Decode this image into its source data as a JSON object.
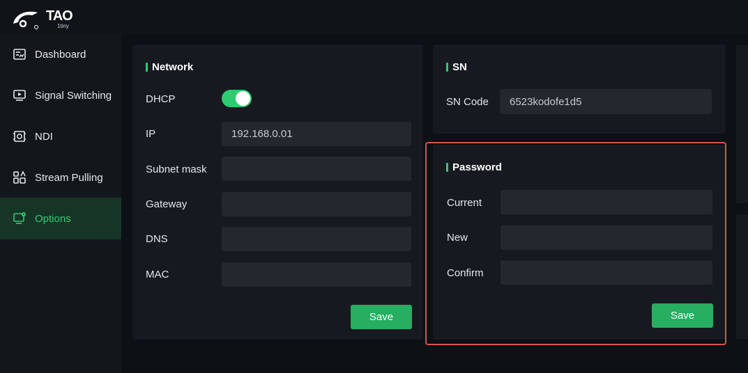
{
  "logo": {
    "name": "TAO",
    "sub": "1tiny"
  },
  "sidebar": {
    "items": [
      {
        "label": "Dashboard",
        "icon": "dashboard-icon",
        "active": false
      },
      {
        "label": "Signal Switching",
        "icon": "monitor-play-icon",
        "active": false
      },
      {
        "label": "NDI",
        "icon": "ndi-icon",
        "active": false
      },
      {
        "label": "Stream Pulling",
        "icon": "stream-icon",
        "active": false
      },
      {
        "label": "Options",
        "icon": "monitor-settings-icon",
        "active": true
      }
    ]
  },
  "network": {
    "title": "Network",
    "dhcp_label": "DHCP",
    "dhcp_on": true,
    "ip_label": "IP",
    "ip_value": "192.168.0.01",
    "subnet_label": "Subnet mask",
    "subnet_value": "",
    "gateway_label": "Gateway",
    "gateway_value": "",
    "dns_label": "DNS",
    "dns_value": "",
    "mac_label": "MAC",
    "mac_value": "",
    "save_label": "Save"
  },
  "sn": {
    "title": "SN",
    "code_label": "SN Code",
    "code_value": "6523kodofe1d5"
  },
  "password": {
    "title": "Password",
    "current_label": "Current",
    "new_label": "New",
    "confirm_label": "Confirm",
    "save_label": "Save"
  },
  "colors": {
    "accent": "#2ecc71",
    "button": "#27ae60",
    "highlight": "#d9534f"
  }
}
